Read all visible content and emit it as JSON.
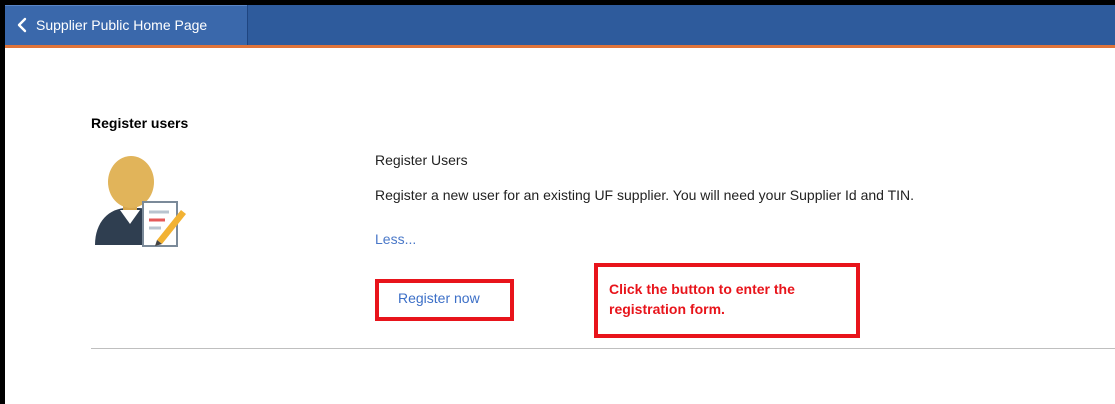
{
  "header": {
    "back_label": "Supplier Public Home Page"
  },
  "section": {
    "title": "Register users"
  },
  "item": {
    "title": "Register Users",
    "description": "Register a new user for an existing UF supplier. You will need your Supplier Id and TIN.",
    "less_label": "Less...",
    "action_label": "Register now"
  },
  "annotation": {
    "callout_line1": "Click the button to enter the",
    "callout_line2": "registration form."
  },
  "colors": {
    "header_bg": "#2e5b9c",
    "header_accent": "#e0743a",
    "link": "#3c6fc7",
    "highlight": "#e8141b"
  },
  "icons": {
    "back": "chevron-left-icon",
    "avatar": "user-register-icon"
  }
}
